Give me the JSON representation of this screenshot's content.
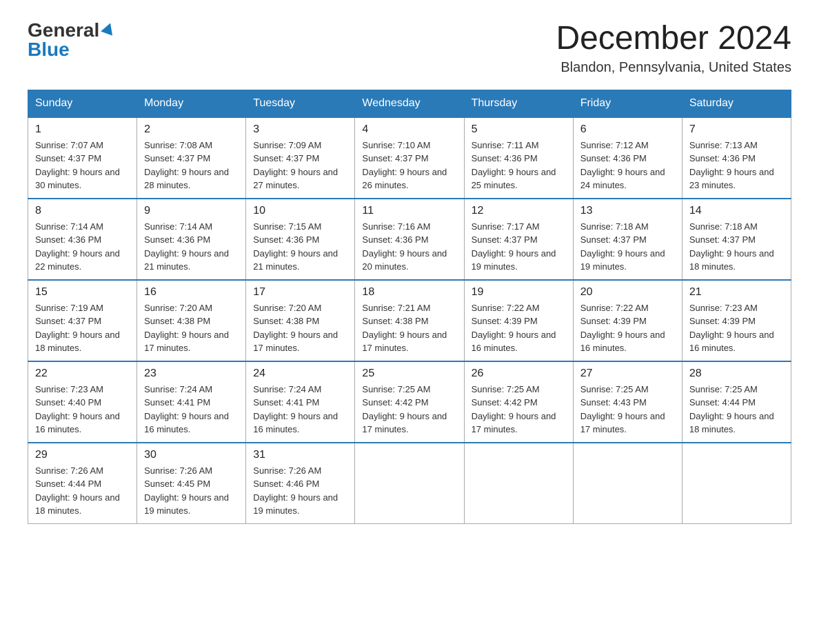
{
  "header": {
    "logo_general": "General",
    "logo_blue": "Blue",
    "month_title": "December 2024",
    "location": "Blandon, Pennsylvania, United States"
  },
  "weekdays": [
    "Sunday",
    "Monday",
    "Tuesday",
    "Wednesday",
    "Thursday",
    "Friday",
    "Saturday"
  ],
  "weeks": [
    [
      {
        "day": "1",
        "sunrise": "7:07 AM",
        "sunset": "4:37 PM",
        "daylight": "9 hours and 30 minutes."
      },
      {
        "day": "2",
        "sunrise": "7:08 AM",
        "sunset": "4:37 PM",
        "daylight": "9 hours and 28 minutes."
      },
      {
        "day": "3",
        "sunrise": "7:09 AM",
        "sunset": "4:37 PM",
        "daylight": "9 hours and 27 minutes."
      },
      {
        "day": "4",
        "sunrise": "7:10 AM",
        "sunset": "4:37 PM",
        "daylight": "9 hours and 26 minutes."
      },
      {
        "day": "5",
        "sunrise": "7:11 AM",
        "sunset": "4:36 PM",
        "daylight": "9 hours and 25 minutes."
      },
      {
        "day": "6",
        "sunrise": "7:12 AM",
        "sunset": "4:36 PM",
        "daylight": "9 hours and 24 minutes."
      },
      {
        "day": "7",
        "sunrise": "7:13 AM",
        "sunset": "4:36 PM",
        "daylight": "9 hours and 23 minutes."
      }
    ],
    [
      {
        "day": "8",
        "sunrise": "7:14 AM",
        "sunset": "4:36 PM",
        "daylight": "9 hours and 22 minutes."
      },
      {
        "day": "9",
        "sunrise": "7:14 AM",
        "sunset": "4:36 PM",
        "daylight": "9 hours and 21 minutes."
      },
      {
        "day": "10",
        "sunrise": "7:15 AM",
        "sunset": "4:36 PM",
        "daylight": "9 hours and 21 minutes."
      },
      {
        "day": "11",
        "sunrise": "7:16 AM",
        "sunset": "4:36 PM",
        "daylight": "9 hours and 20 minutes."
      },
      {
        "day": "12",
        "sunrise": "7:17 AM",
        "sunset": "4:37 PM",
        "daylight": "9 hours and 19 minutes."
      },
      {
        "day": "13",
        "sunrise": "7:18 AM",
        "sunset": "4:37 PM",
        "daylight": "9 hours and 19 minutes."
      },
      {
        "day": "14",
        "sunrise": "7:18 AM",
        "sunset": "4:37 PM",
        "daylight": "9 hours and 18 minutes."
      }
    ],
    [
      {
        "day": "15",
        "sunrise": "7:19 AM",
        "sunset": "4:37 PM",
        "daylight": "9 hours and 18 minutes."
      },
      {
        "day": "16",
        "sunrise": "7:20 AM",
        "sunset": "4:38 PM",
        "daylight": "9 hours and 17 minutes."
      },
      {
        "day": "17",
        "sunrise": "7:20 AM",
        "sunset": "4:38 PM",
        "daylight": "9 hours and 17 minutes."
      },
      {
        "day": "18",
        "sunrise": "7:21 AM",
        "sunset": "4:38 PM",
        "daylight": "9 hours and 17 minutes."
      },
      {
        "day": "19",
        "sunrise": "7:22 AM",
        "sunset": "4:39 PM",
        "daylight": "9 hours and 16 minutes."
      },
      {
        "day": "20",
        "sunrise": "7:22 AM",
        "sunset": "4:39 PM",
        "daylight": "9 hours and 16 minutes."
      },
      {
        "day": "21",
        "sunrise": "7:23 AM",
        "sunset": "4:39 PM",
        "daylight": "9 hours and 16 minutes."
      }
    ],
    [
      {
        "day": "22",
        "sunrise": "7:23 AM",
        "sunset": "4:40 PM",
        "daylight": "9 hours and 16 minutes."
      },
      {
        "day": "23",
        "sunrise": "7:24 AM",
        "sunset": "4:41 PM",
        "daylight": "9 hours and 16 minutes."
      },
      {
        "day": "24",
        "sunrise": "7:24 AM",
        "sunset": "4:41 PM",
        "daylight": "9 hours and 16 minutes."
      },
      {
        "day": "25",
        "sunrise": "7:25 AM",
        "sunset": "4:42 PM",
        "daylight": "9 hours and 17 minutes."
      },
      {
        "day": "26",
        "sunrise": "7:25 AM",
        "sunset": "4:42 PM",
        "daylight": "9 hours and 17 minutes."
      },
      {
        "day": "27",
        "sunrise": "7:25 AM",
        "sunset": "4:43 PM",
        "daylight": "9 hours and 17 minutes."
      },
      {
        "day": "28",
        "sunrise": "7:25 AM",
        "sunset": "4:44 PM",
        "daylight": "9 hours and 18 minutes."
      }
    ],
    [
      {
        "day": "29",
        "sunrise": "7:26 AM",
        "sunset": "4:44 PM",
        "daylight": "9 hours and 18 minutes."
      },
      {
        "day": "30",
        "sunrise": "7:26 AM",
        "sunset": "4:45 PM",
        "daylight": "9 hours and 19 minutes."
      },
      {
        "day": "31",
        "sunrise": "7:26 AM",
        "sunset": "4:46 PM",
        "daylight": "9 hours and 19 minutes."
      },
      null,
      null,
      null,
      null
    ]
  ]
}
